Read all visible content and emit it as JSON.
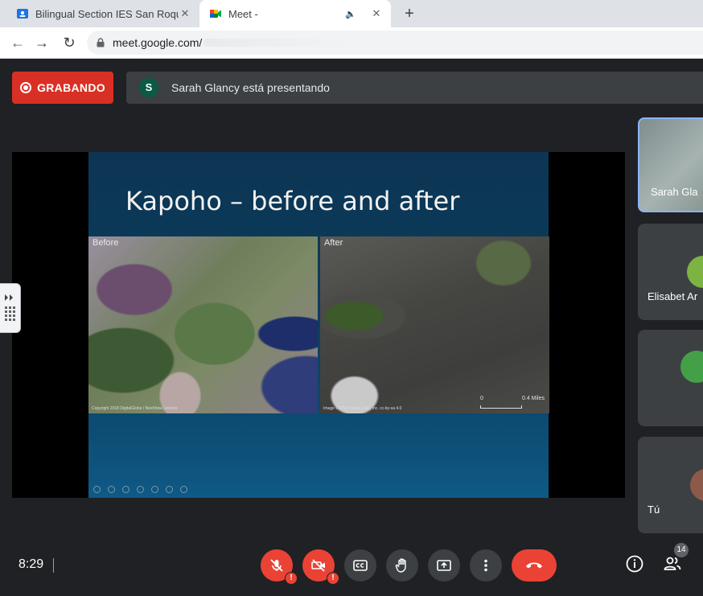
{
  "browser": {
    "tabs": [
      {
        "title": "Bilingual Section IES San Roque",
        "active": false
      },
      {
        "title": "Meet -",
        "active": true
      }
    ],
    "new_tab_label": "+",
    "url": "meet.google.com/",
    "close_glyph": "✕",
    "audio_glyph": "🔈"
  },
  "meet": {
    "recording_label": "GRABANDO",
    "presenter_initial": "S",
    "presenter_text": "Sarah Glancy está presentando",
    "accent_color": "#8ab4f8",
    "record_color": "#d93025",
    "presenter_avatar_color": "#0b5a44"
  },
  "slide": {
    "title": "Kapoho – before and after",
    "before_label": "Before",
    "after_label": "After",
    "before_credit": "Copyright 2018 DigitalGlobe / NextView License",
    "after_credit": "Image ©2018 Planet Labs, Inc. cc-by-sa 4.0",
    "scale_start": "0",
    "scale_end": "0.4 Miles"
  },
  "participants": [
    {
      "name": "Sarah Glancy",
      "display": "Sarah Gla"
    },
    {
      "name": "Elisabet A",
      "display": "Elisabet Ar"
    },
    {
      "name": "",
      "display": ""
    },
    {
      "name": "Tú",
      "display": "Tú"
    }
  ],
  "controls": {
    "time": "8:29",
    "participant_count": "14",
    "warning_glyph": "!",
    "icons": [
      "mic-off-icon",
      "camera-off-icon",
      "captions-icon",
      "raise-hand-icon",
      "present-screen-icon",
      "more-options-icon",
      "hang-up-icon",
      "info-icon",
      "people-icon"
    ]
  }
}
